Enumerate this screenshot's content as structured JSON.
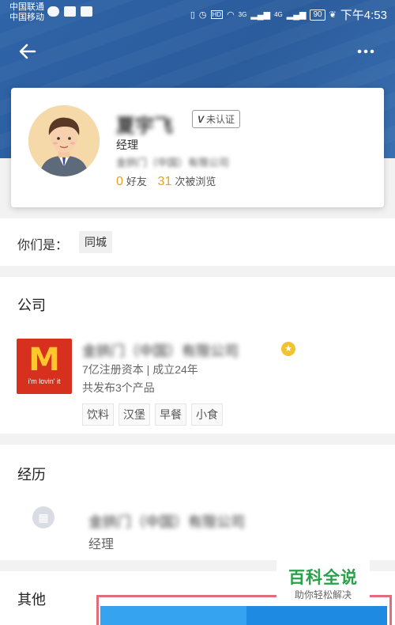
{
  "status_bar": {
    "carrier_1": "中国联通",
    "carrier_2": "中国移动",
    "battery": "90",
    "time": "下午4:53",
    "network_1": "3G",
    "network_2": "4G"
  },
  "profile": {
    "name": "夏宇飞",
    "cert_mark": "V",
    "cert_label": "未认证",
    "title": "经理",
    "company": "金拱门（中国）有限公司",
    "friends_count": "0",
    "friends_label": "好友",
    "views_count": "31",
    "views_label": "次被浏览"
  },
  "relationship": {
    "label": "你们是：",
    "tag": "同城"
  },
  "company_section": {
    "title": "公司",
    "logo_mark": "M",
    "logo_text": "i'm lovin' it",
    "name": "金拱门（中国）有限公司",
    "badge_icon": "star-badge-icon",
    "info": "7亿注册资本 | 成立24年",
    "products": "共发布3个产品",
    "tags": [
      "饮料",
      "汉堡",
      "早餐",
      "小食"
    ]
  },
  "experience_section": {
    "title": "经历",
    "company": "金拱门（中国）有限公司",
    "role": "经理"
  },
  "other_section": {
    "title": "其他"
  },
  "watermark": {
    "title": "百科全说",
    "subtitle": "助你轻松解决"
  },
  "colors": {
    "header_blue": "#2f64a8",
    "accent_orange": "#e8a020",
    "watermark_green": "#2aa04a",
    "button_light_blue": "#36a3f0",
    "button_blue": "#1f8ae2"
  }
}
